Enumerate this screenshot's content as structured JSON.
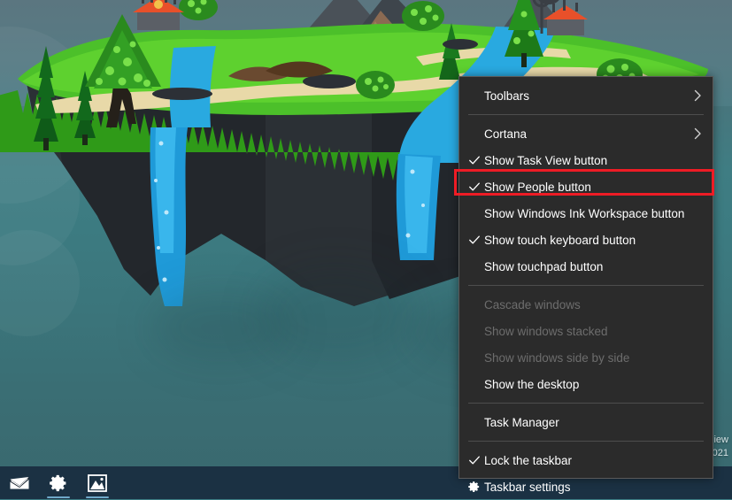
{
  "desktop": {
    "wallpaper_name": "floating-island-wallpaper",
    "background_colors": {
      "sky_top": "#5b7680",
      "sky_bottom": "#39686e",
      "grass": "#4cc02a",
      "grass_dark": "#2f9a18",
      "rock": "#2e3338",
      "water": "#29a9e0",
      "sand": "#e8d9a8",
      "roof": "#e8502a"
    }
  },
  "taskbar": {
    "background_color": "#1b3143",
    "items": [
      {
        "name": "mail-icon",
        "label": "Mail",
        "active": false
      },
      {
        "name": "settings-icon",
        "label": "Settings",
        "active": true
      },
      {
        "name": "photos-icon",
        "label": "Photos",
        "active": true
      }
    ]
  },
  "watermark": {
    "line1": "iew",
    "line2": "021"
  },
  "context_menu": {
    "name": "taskbar-context-menu",
    "background_color": "#2b2b2b",
    "border_color": "#5a5a5a",
    "highlight_color": "#ee1c25",
    "items": [
      {
        "id": "toolbars",
        "label": "Toolbars",
        "checked": false,
        "disabled": false,
        "submenu": true,
        "icon": null
      },
      {
        "id": "separator-1",
        "label": "",
        "separator": true
      },
      {
        "id": "cortana",
        "label": "Cortana",
        "checked": false,
        "disabled": false,
        "submenu": true,
        "icon": null
      },
      {
        "id": "show-task-view",
        "label": "Show Task View button",
        "checked": true,
        "disabled": false,
        "submenu": false,
        "icon": null
      },
      {
        "id": "show-people",
        "label": "Show People button",
        "checked": true,
        "disabled": false,
        "submenu": false,
        "icon": null,
        "highlighted": true
      },
      {
        "id": "show-windows-ink",
        "label": "Show Windows Ink Workspace button",
        "checked": false,
        "disabled": false,
        "submenu": false,
        "icon": null
      },
      {
        "id": "show-touch-keyboard",
        "label": "Show touch keyboard button",
        "checked": true,
        "disabled": false,
        "submenu": false,
        "icon": null
      },
      {
        "id": "show-touchpad",
        "label": "Show touchpad button",
        "checked": false,
        "disabled": false,
        "submenu": false,
        "icon": null
      },
      {
        "id": "separator-2",
        "label": "",
        "separator": true
      },
      {
        "id": "cascade-windows",
        "label": "Cascade windows",
        "checked": false,
        "disabled": true,
        "submenu": false,
        "icon": null
      },
      {
        "id": "show-windows-stacked",
        "label": "Show windows stacked",
        "checked": false,
        "disabled": true,
        "submenu": false,
        "icon": null
      },
      {
        "id": "show-windows-side",
        "label": "Show windows side by side",
        "checked": false,
        "disabled": true,
        "submenu": false,
        "icon": null
      },
      {
        "id": "show-the-desktop",
        "label": "Show the desktop",
        "checked": false,
        "disabled": false,
        "submenu": false,
        "icon": null
      },
      {
        "id": "separator-3",
        "label": "",
        "separator": true
      },
      {
        "id": "task-manager",
        "label": "Task Manager",
        "checked": false,
        "disabled": false,
        "submenu": false,
        "icon": null
      },
      {
        "id": "separator-4",
        "label": "",
        "separator": true
      },
      {
        "id": "lock-the-taskbar",
        "label": "Lock the taskbar",
        "checked": true,
        "disabled": false,
        "submenu": false,
        "icon": null
      },
      {
        "id": "taskbar-settings",
        "label": "Taskbar settings",
        "checked": false,
        "disabled": false,
        "submenu": false,
        "icon": "gear-icon"
      }
    ]
  }
}
